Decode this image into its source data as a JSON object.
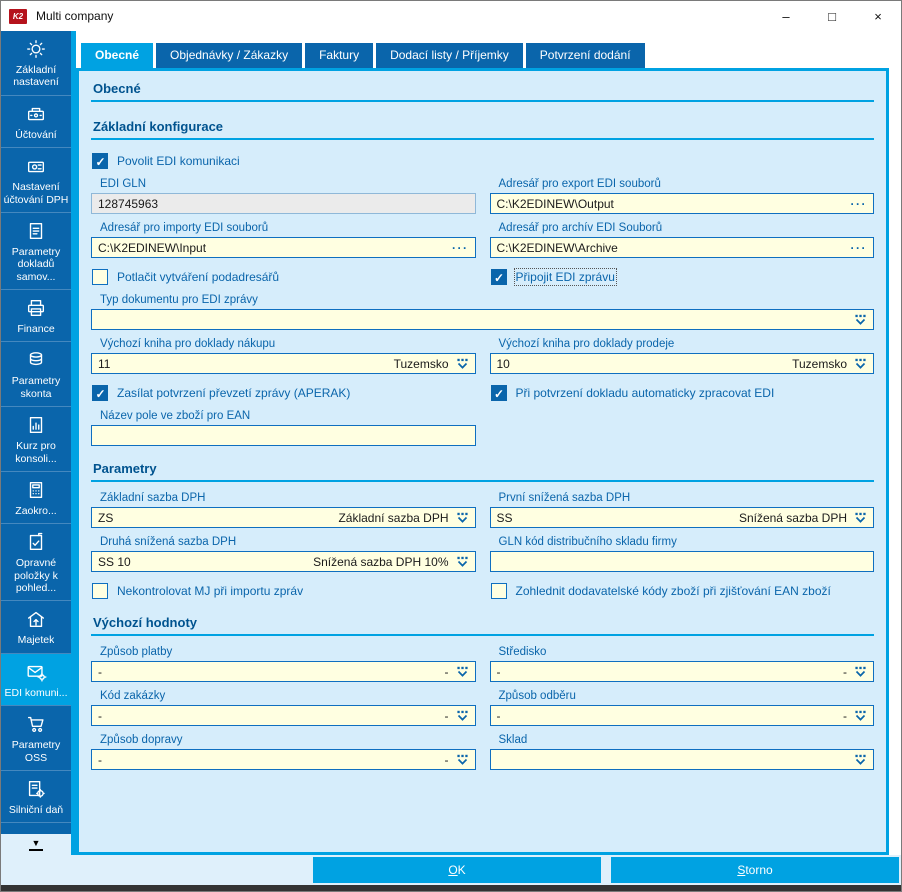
{
  "window": {
    "title": "Multi company",
    "logo_text": "K2",
    "controls": {
      "minimize": "–",
      "maximize": "□",
      "close": "×"
    }
  },
  "tabs": [
    {
      "label": "Obecné",
      "active": true
    },
    {
      "label": "Objednávky / Zákazky",
      "active": false
    },
    {
      "label": "Faktury",
      "active": false
    },
    {
      "label": "Dodací listy / Příjemky",
      "active": false
    },
    {
      "label": "Potvrzení dodání",
      "active": false
    }
  ],
  "sidebar": {
    "items": [
      {
        "icon": "gear-icon",
        "label": "Základní nastavení",
        "selected": false
      },
      {
        "icon": "cash-register-icon",
        "label": "Účtování",
        "selected": false
      },
      {
        "icon": "vat-settings-icon",
        "label": "Nastavení účtování DPH",
        "selected": false
      },
      {
        "icon": "document-icon",
        "label": "Parametry dokladů samov...",
        "selected": false
      },
      {
        "icon": "printer-icon",
        "label": "Finance",
        "selected": false
      },
      {
        "icon": "coins-icon",
        "label": "Parametry skonta",
        "selected": false
      },
      {
        "icon": "chart-document-icon",
        "label": "Kurz pro konsoli...",
        "selected": false
      },
      {
        "icon": "calculator-icon",
        "label": "Zaokro...",
        "selected": false
      },
      {
        "icon": "document-check-icon",
        "label": "Opravné položky k pohled...",
        "selected": false
      },
      {
        "icon": "asset-icon",
        "label": "Majetek",
        "selected": false
      },
      {
        "icon": "edi-envelope-gear-icon",
        "label": "EDI komuni...",
        "selected": true
      },
      {
        "icon": "cart-icon",
        "label": "Parametry OSS",
        "selected": false
      },
      {
        "icon": "road-tax-icon",
        "label": "Silniční daň",
        "selected": false
      }
    ],
    "scroll_more_icon": "▼"
  },
  "form": {
    "sections": {
      "obecne": "Obecné",
      "zakladni_konfigurace": "Základní konfigurace",
      "parametry": "Parametry",
      "vychozi_hodnoty": "Výchozí hodnoty"
    },
    "checkboxes": {
      "povolit_edi": {
        "label": "Povolit EDI komunikaci",
        "checked": true
      },
      "potlacit": {
        "label": "Potlačit vytváření podadresářů",
        "checked": false
      },
      "pripojit": {
        "label": "Připojit EDI zprávu",
        "checked": true
      },
      "aperak": {
        "label": "Zasílat potvrzení převzetí zprávy (APERAK)",
        "checked": true
      },
      "auto_zpracovat": {
        "label": "Při potvrzení dokladu automaticky zpracovat EDI",
        "checked": true
      },
      "nekontrolovat_mj": {
        "label": "Nekontrolovat MJ při importu zpráv",
        "checked": false
      },
      "zohlednit_kody": {
        "label": "Zohlednit dodavatelské kódy zboží při zjišťování EAN zboží",
        "checked": false
      }
    },
    "fields": {
      "edi_gln": {
        "label": "EDI GLN",
        "value": "128745963"
      },
      "export_dir": {
        "label": "Adresář pro export EDI souborů",
        "value": "C:\\K2EDINEW\\Output"
      },
      "import_dir": {
        "label": "Adresář pro importy EDI souborů",
        "value": "C:\\K2EDINEW\\Input"
      },
      "archive_dir": {
        "label": "Adresář pro archív EDI Souborů",
        "value": "C:\\K2EDINEW\\Archive"
      },
      "typ_dokumentu": {
        "label": "Typ dokumentu pro EDI zprávy",
        "value": ""
      },
      "kniha_nakup": {
        "label": "Výchozí kniha pro doklady nákupu",
        "value": "11",
        "value_right": "Tuzemsko"
      },
      "kniha_prodej": {
        "label": "Výchozí kniha pro doklady prodeje",
        "value": "10",
        "value_right": "Tuzemsko"
      },
      "ean_pole": {
        "label": "Název pole ve zboží pro EAN",
        "value": ""
      },
      "zakladni_sazba": {
        "label": "Základní sazba DPH",
        "value": "ZS",
        "value_right": "Základní sazba DPH"
      },
      "prvni_snizena": {
        "label": "První snížená sazba DPH",
        "value": "SS",
        "value_right": "Snížená sazba DPH"
      },
      "druha_snizena": {
        "label": "Druhá snížená sazba DPH",
        "value": "SS 10",
        "value_right": "Snížená sazba DPH 10%"
      },
      "gln_sklad": {
        "label": "GLN kód distribučního skladu firmy",
        "value": ""
      },
      "zpusob_platby": {
        "label": "Způsob platby",
        "value": "-",
        "value_right": "-"
      },
      "stredisko": {
        "label": "Středisko",
        "value": "-",
        "value_right": "-"
      },
      "kod_zakazky": {
        "label": "Kód zakázky",
        "value": "-",
        "value_right": "-"
      },
      "zpusob_odberu": {
        "label": "Způsob odběru",
        "value": "-",
        "value_right": "-"
      },
      "zpusob_dopravy": {
        "label": "Způsob dopravy",
        "value": "-",
        "value_right": "-"
      },
      "sklad": {
        "label": "Sklad",
        "value": ""
      }
    }
  },
  "footer": {
    "ok": {
      "first": "O",
      "rest": "K"
    },
    "storno": {
      "first": "S",
      "rest": "torno"
    }
  },
  "colors": {
    "accent_dark_blue": "#0a65ab",
    "accent_bright_blue": "#00a2e2",
    "panel_bg": "#d6edfb",
    "input_bg": "#ffffe1",
    "input_border": "#0f6fc0",
    "disabled_input_bg": "#ebebeb",
    "heading_text": "#00538f",
    "logo_red": "#b5121c"
  }
}
